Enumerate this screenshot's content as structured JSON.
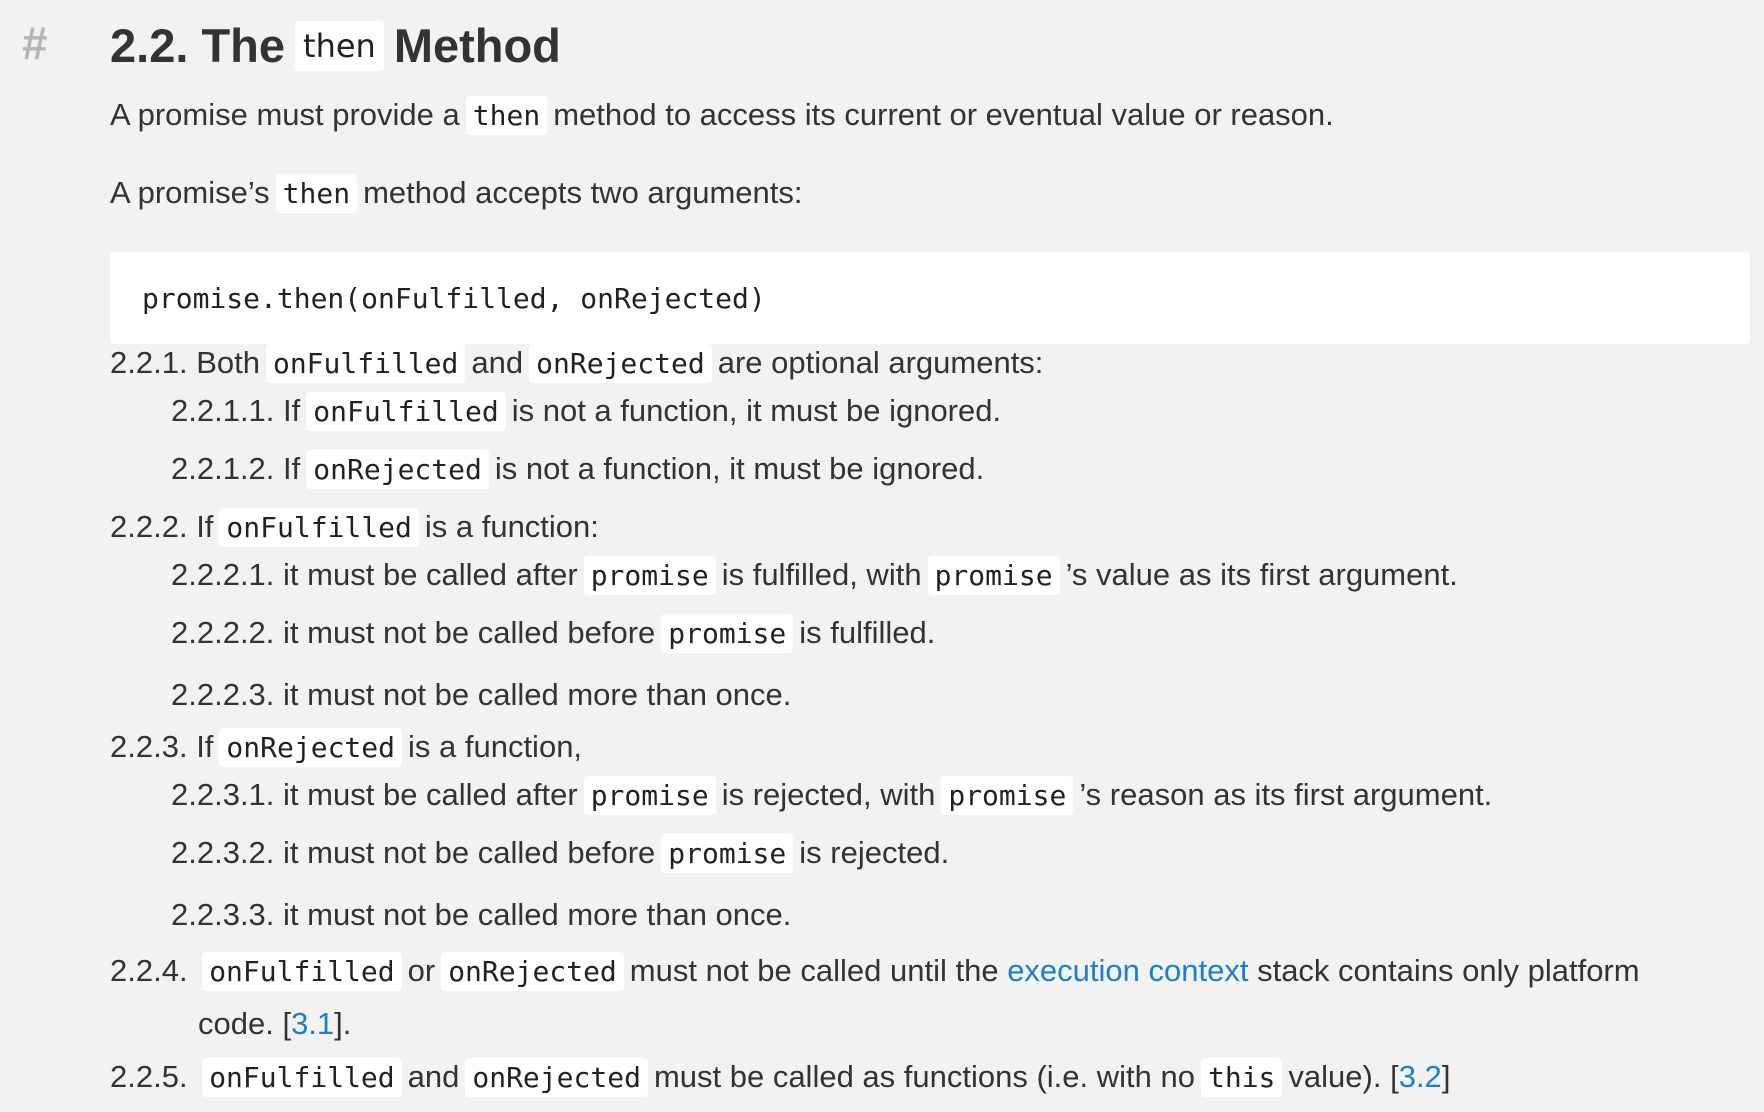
{
  "anchor": "#",
  "heading": {
    "number": "2.2. The",
    "code": "then",
    "suffix": "Method"
  },
  "intro": {
    "p1_before": "A promise must provide a",
    "p1_code": "then",
    "p1_after": "method to access its current or eventual value or reason.",
    "p2_before": "A promise’s",
    "p2_code": "then",
    "p2_after": "method accepts two arguments:"
  },
  "code_block": "promise.then(onFulfilled, onRejected)",
  "items": {
    "i221": {
      "num": "2.2.1.",
      "t1": "Both",
      "c1": "onFulfilled",
      "t2": "and",
      "c2": "onRejected",
      "t3": "are optional arguments:"
    },
    "i2211": {
      "num": "2.2.1.1.",
      "t1": "If",
      "c1": "onFulfilled",
      "t2": "is not a function, it must be ignored."
    },
    "i2212": {
      "num": "2.2.1.2.",
      "t1": "If",
      "c1": "onRejected",
      "t2": "is not a function, it must be ignored."
    },
    "i222": {
      "num": "2.2.2.",
      "t1": "If",
      "c1": "onFulfilled",
      "t2": "is a function:"
    },
    "i2221": {
      "num": "2.2.2.1.",
      "t1": "it must be called after",
      "c1": "promise",
      "t2": "is fulfilled, with",
      "c2": "promise",
      "t3": "’s value as its first argument."
    },
    "i2222": {
      "num": "2.2.2.2.",
      "t1": "it must not be called before",
      "c1": "promise",
      "t2": "is fulfilled."
    },
    "i2223": {
      "num": "2.2.2.3.",
      "t1": "it must not be called more than once."
    },
    "i223": {
      "num": "2.2.3.",
      "t1": "If",
      "c1": "onRejected",
      "t2": "is a function,"
    },
    "i2231": {
      "num": "2.2.3.1.",
      "t1": "it must be called after",
      "c1": "promise",
      "t2": "is rejected, with",
      "c2": "promise",
      "t3": "’s reason as its first argument."
    },
    "i2232": {
      "num": "2.2.3.2.",
      "t1": "it must not be called before",
      "c1": "promise",
      "t2": "is rejected."
    },
    "i2233": {
      "num": "2.2.3.3.",
      "t1": "it must not be called more than once."
    },
    "i224": {
      "num": "2.2.4.",
      "c1": "onFulfilled",
      "t1": "or",
      "c2": "onRejected",
      "t2": "must not be called until the",
      "link": "execution context",
      "t3": "stack contains only platform",
      "t4": "code. [",
      "ref": "3.1",
      "t5": "]."
    },
    "i225": {
      "num": "2.2.5.",
      "c1": "onFulfilled",
      "t1": "and",
      "c2": "onRejected",
      "t2": "must be called as functions (i.e. with no",
      "c3": "this",
      "t3": "value). [",
      "ref": "3.2",
      "t4": "]"
    }
  },
  "colors": {
    "background": "#f2f2f2",
    "text": "#333333",
    "link": "#1a7fd0",
    "anchor": "#b5b5b5"
  }
}
